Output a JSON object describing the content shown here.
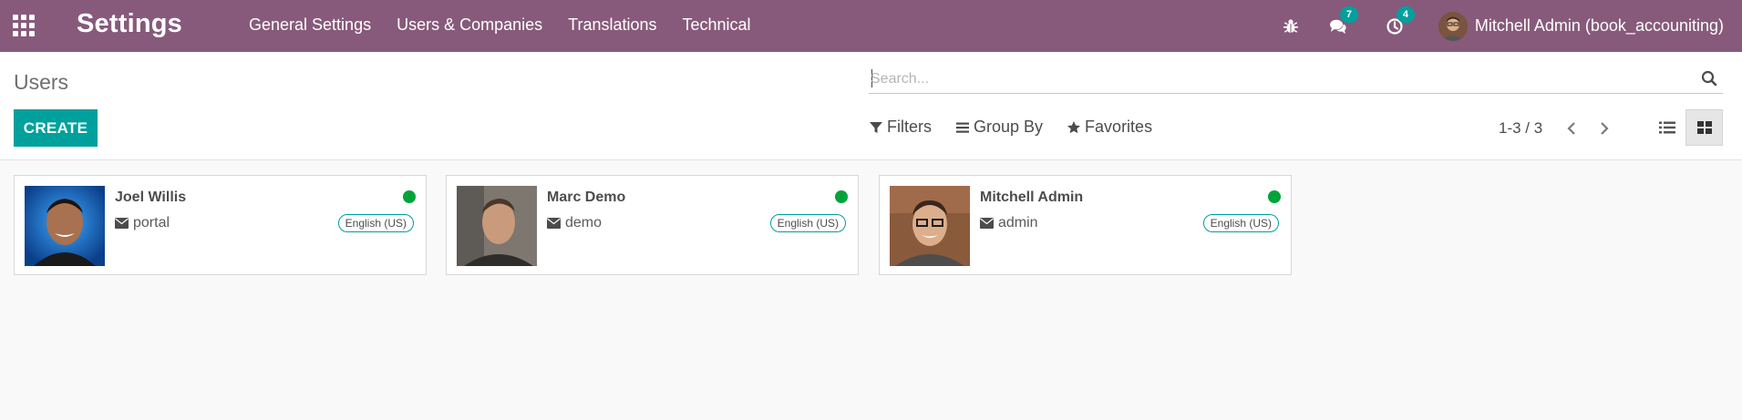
{
  "navbar": {
    "app_title": "Settings",
    "menu": [
      "General Settings",
      "Users & Companies",
      "Translations",
      "Technical"
    ],
    "messages_count": "7",
    "activities_count": "4",
    "user_name": "Mitchell Admin (book_accouniting)",
    "icons": {
      "apps": "apps-grid-icon",
      "debug": "bug-icon",
      "messages": "comments-icon",
      "activities": "clock-icon"
    }
  },
  "control_panel": {
    "breadcrumb": "Users",
    "create_label": "CREATE",
    "search_placeholder": "Search...",
    "filters_label": "Filters",
    "group_by_label": "Group By",
    "favorites_label": "Favorites",
    "pager_value": "1-3 / 3"
  },
  "users": [
    {
      "name": "Joel Willis",
      "login": "portal",
      "language": "English (US)",
      "status": "online"
    },
    {
      "name": "Marc Demo",
      "login": "demo",
      "language": "English (US)",
      "status": "online"
    },
    {
      "name": "Mitchell Admin",
      "login": "admin",
      "language": "English (US)",
      "status": "online"
    }
  ],
  "colors": {
    "navbar": "#875a7b",
    "primary": "#00a09d",
    "online": "#00a33a",
    "background": "#f9f9f9"
  }
}
